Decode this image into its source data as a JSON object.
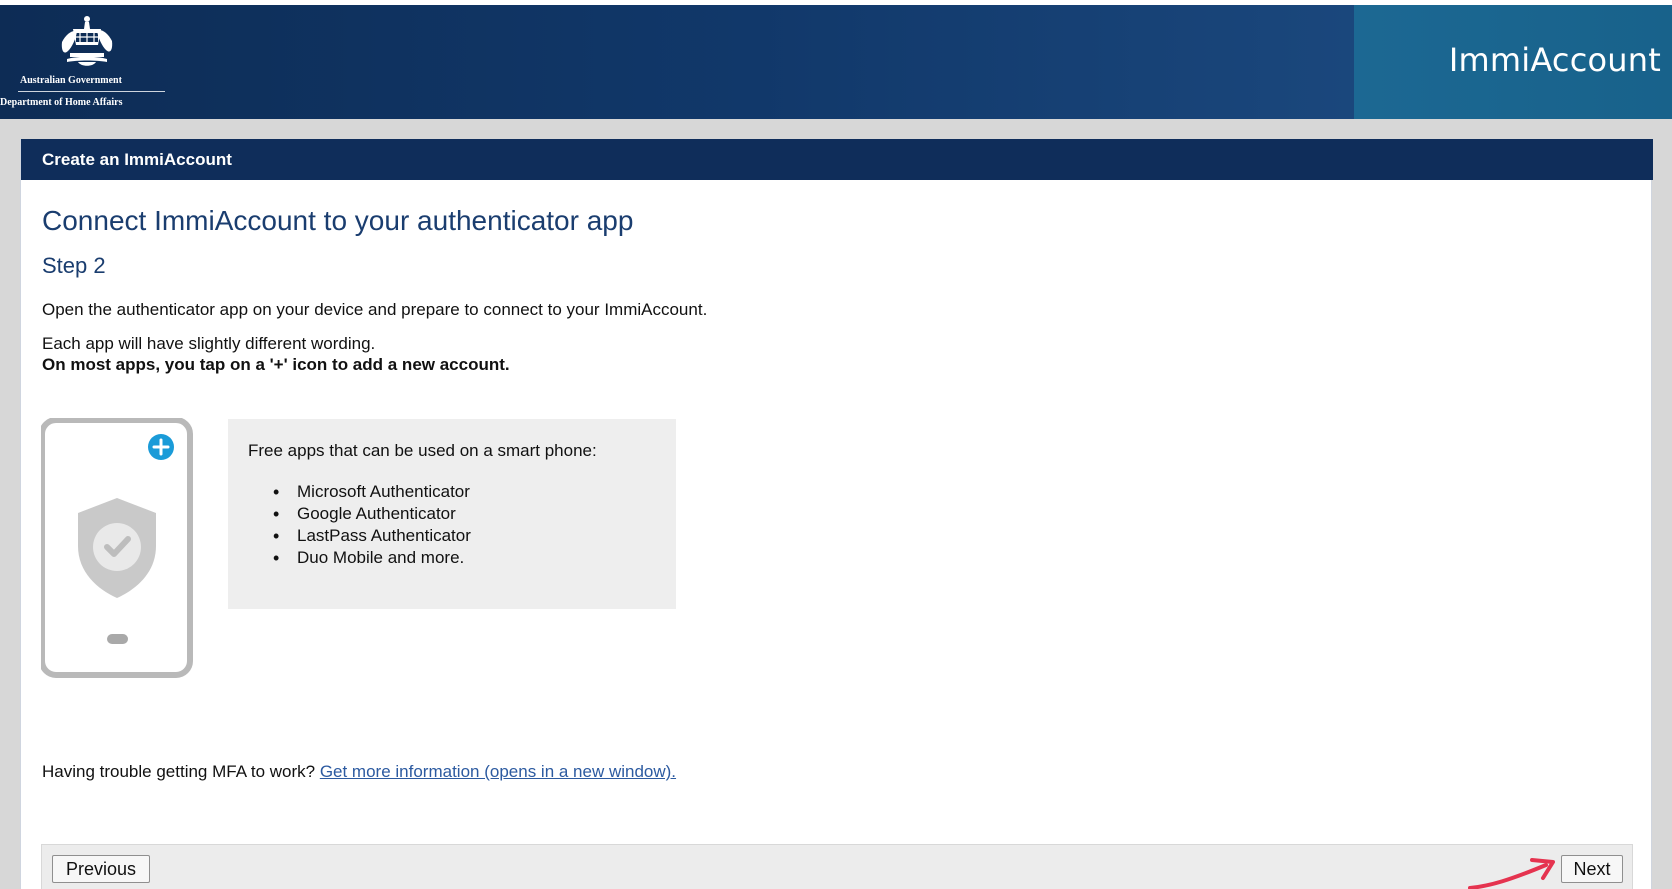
{
  "header": {
    "government": "Australian Government",
    "department": "Department of Home Affairs",
    "brand": "ImmiAccount"
  },
  "section": {
    "title": "Create an ImmiAccount"
  },
  "main": {
    "title": "Connect ImmiAccount to your authenticator app",
    "step": "Step 2",
    "intro": "Open the authenticator app on your device and prepare to connect to your ImmiAccount.",
    "wording": "Each app will have slightly different wording.",
    "wording_bold": "On most apps, you tap on a '+' icon to add a new account.",
    "apps_heading": "Free apps that can be used on a smart phone:",
    "apps": [
      "Microsoft Authenticator",
      "Google Authenticator",
      "LastPass Authenticator",
      "Duo Mobile and more."
    ],
    "help_prefix": "Having trouble getting MFA to work? ",
    "help_link": "Get more information (opens in a new window)."
  },
  "footer": {
    "previous_label": "Previous",
    "next_label": "Next"
  },
  "icons": {
    "crest": "crest-icon",
    "phone": "phone-icon",
    "shield": "shield-check-icon",
    "plus": "plus-circle-icon",
    "annotation_arrow": "arrow-icon"
  },
  "colors": {
    "header_blue": "#0d2c55",
    "header_brand_panel": "#1c6893",
    "section_blue": "#0f2d5a",
    "heading_blue": "#1a3d6f",
    "link_blue": "#2c5aa0",
    "plus_blue": "#1a9bd8",
    "annotation_red": "#e5334f"
  }
}
